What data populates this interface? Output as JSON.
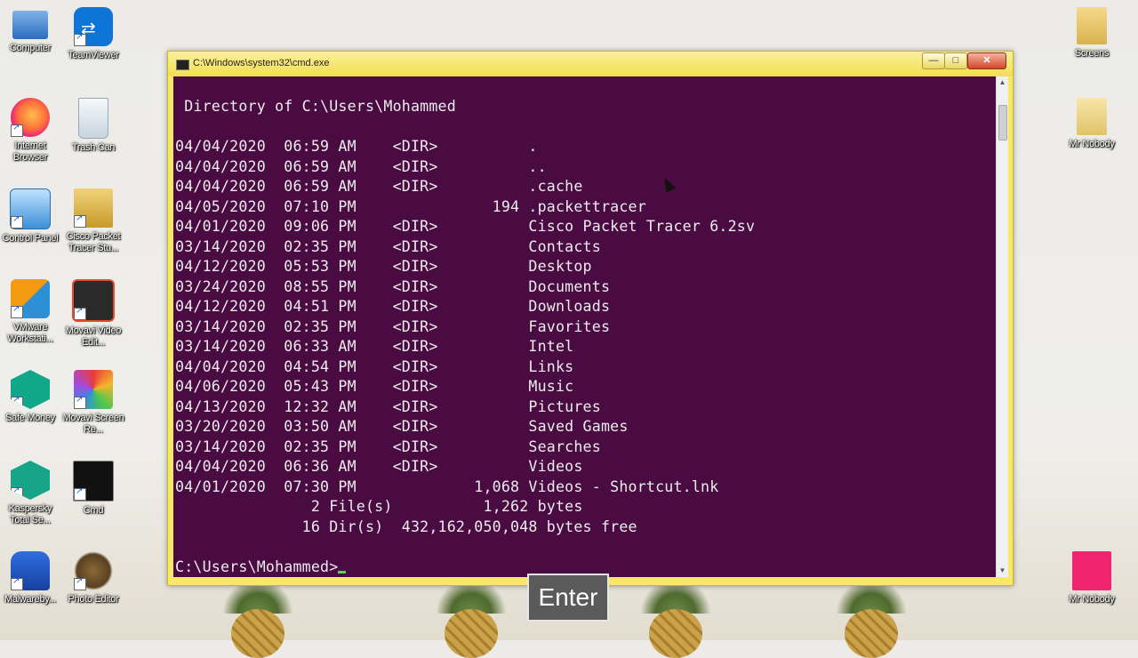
{
  "desktop": {
    "left_col_1": [
      {
        "label": "Computer",
        "icon": "computer-icon"
      },
      {
        "label": "Internet Browser",
        "icon": "firefox-icon"
      },
      {
        "label": "Control Panel",
        "icon": "control-panel-icon"
      },
      {
        "label": "VMware Workstati...",
        "icon": "vmware-icon"
      },
      {
        "label": "Safe Money",
        "icon": "safe-money-icon"
      },
      {
        "label": "Kaspersky Total Se...",
        "icon": "kaspersky-icon"
      },
      {
        "label": "Malwareby...",
        "icon": "malwarebytes-icon"
      }
    ],
    "left_col_2": [
      {
        "label": "TeamViewer",
        "icon": "teamviewer-icon"
      },
      {
        "label": "Trash Can",
        "icon": "trash-can-icon"
      },
      {
        "label": "Cisco Packet Tracer Stu...",
        "icon": "cisco-packet-tracer-icon"
      },
      {
        "label": "Movavi Video Edit...",
        "icon": "movavi-video-icon"
      },
      {
        "label": "Movavi Screen Re...",
        "icon": "movavi-screen-icon"
      },
      {
        "label": "Cmd",
        "icon": "cmd-icon"
      },
      {
        "label": "Photo Editor",
        "icon": "photo-editor-icon"
      }
    ],
    "right_col": [
      {
        "label": "Screens",
        "icon": "folder-icon"
      },
      {
        "label": "Mr Nobody",
        "icon": "folder-icon"
      },
      {
        "label": "Mr Nobody",
        "icon": "image-file-icon"
      }
    ]
  },
  "window": {
    "title": "C:\\Windows\\system32\\cmd.exe",
    "min": "—",
    "max": "□",
    "close": "✕"
  },
  "console": {
    "header": " Directory of C:\\Users\\Mohammed",
    "rows": [
      "04/04/2020  06:59 AM    <DIR>          .",
      "04/04/2020  06:59 AM    <DIR>          ..",
      "04/04/2020  06:59 AM    <DIR>          .cache",
      "04/05/2020  07:10 PM               194 .packettracer",
      "04/01/2020  09:06 PM    <DIR>          Cisco Packet Tracer 6.2sv",
      "03/14/2020  02:35 PM    <DIR>          Contacts",
      "04/12/2020  05:53 PM    <DIR>          Desktop",
      "03/24/2020  08:55 PM    <DIR>          Documents",
      "04/12/2020  04:51 PM    <DIR>          Downloads",
      "03/14/2020  02:35 PM    <DIR>          Favorites",
      "03/14/2020  06:33 AM    <DIR>          Intel",
      "04/04/2020  04:54 PM    <DIR>          Links",
      "04/06/2020  05:43 PM    <DIR>          Music",
      "04/13/2020  12:32 AM    <DIR>          Pictures",
      "03/20/2020  03:50 AM    <DIR>          Saved Games",
      "03/14/2020  02:35 PM    <DIR>          Searches",
      "04/04/2020  06:36 AM    <DIR>          Videos",
      "04/01/2020  07:30 PM             1,068 Videos - Shortcut.lnk"
    ],
    "summary_files": "               2 File(s)          1,262 bytes",
    "summary_dirs": "              16 Dir(s)  432,162,050,048 bytes free",
    "prompt": "C:\\Users\\Mohammed>"
  },
  "overlay": {
    "key_label": "Enter"
  },
  "colors": {
    "console_bg": "#4a0a42",
    "window_frame": "#f7e86a",
    "cursor": "#5fd05f"
  }
}
